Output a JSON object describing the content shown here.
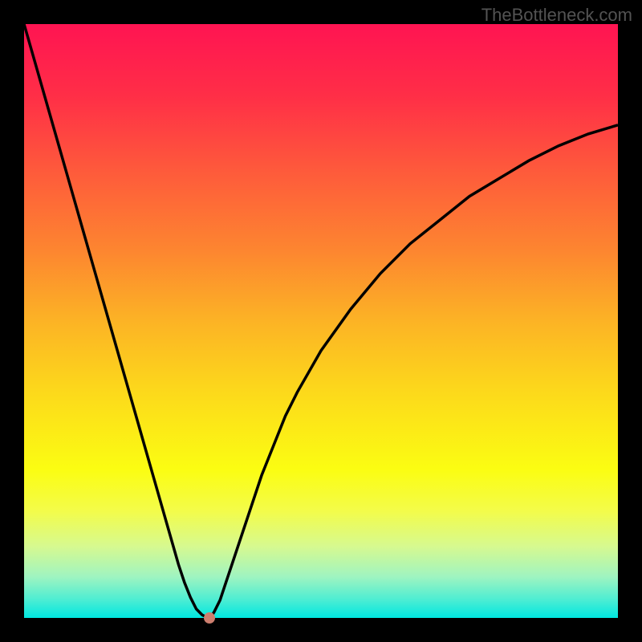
{
  "watermark": "TheBottleneck.com",
  "chart_data": {
    "type": "line",
    "title": "",
    "xlabel": "",
    "ylabel": "",
    "x": [
      0,
      2,
      4,
      6,
      8,
      10,
      12,
      14,
      16,
      18,
      20,
      22,
      24,
      25,
      26,
      27,
      28,
      29,
      30,
      31,
      31.5,
      32,
      33,
      34,
      35,
      36,
      38,
      40,
      42,
      44,
      46,
      50,
      55,
      60,
      65,
      70,
      75,
      80,
      85,
      90,
      95,
      100
    ],
    "values": [
      100,
      93,
      86,
      79,
      72,
      65,
      58,
      51,
      44,
      37,
      30,
      23,
      16,
      12.5,
      9,
      6,
      3.5,
      1.5,
      0.5,
      0,
      0.2,
      1,
      3,
      6,
      9,
      12,
      18,
      24,
      29,
      34,
      38,
      45,
      52,
      58,
      63,
      67,
      71,
      74,
      77,
      79.5,
      81.5,
      83
    ],
    "xlim": [
      0,
      100
    ],
    "ylim": [
      0,
      100
    ],
    "marker": {
      "x": 31.2,
      "y": 0
    },
    "gradient_stops": [
      {
        "offset": 0,
        "color": "#FF1452"
      },
      {
        "offset": 12,
        "color": "#FF2E47"
      },
      {
        "offset": 25,
        "color": "#FE5B3B"
      },
      {
        "offset": 38,
        "color": "#FD8530"
      },
      {
        "offset": 50,
        "color": "#FCB325"
      },
      {
        "offset": 62,
        "color": "#FCD91B"
      },
      {
        "offset": 75,
        "color": "#FBFD12"
      },
      {
        "offset": 82,
        "color": "#F3FC4A"
      },
      {
        "offset": 88,
        "color": "#D6F990"
      },
      {
        "offset": 93,
        "color": "#A0F4C0"
      },
      {
        "offset": 97,
        "color": "#4BEDD3"
      },
      {
        "offset": 100,
        "color": "#00E7E0"
      }
    ]
  }
}
